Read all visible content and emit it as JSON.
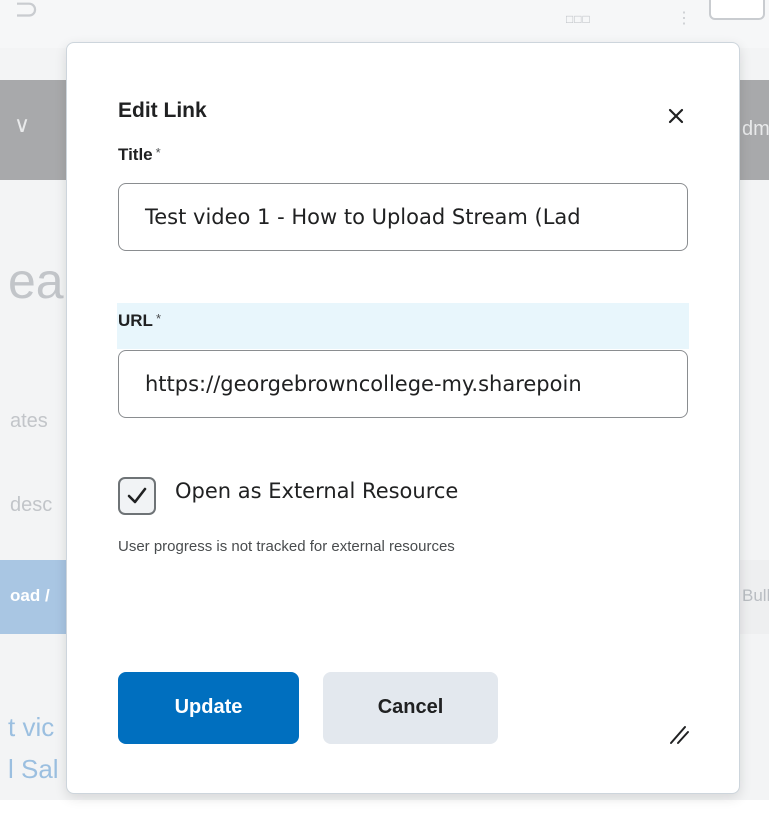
{
  "dialog": {
    "title": "Edit Link",
    "close_icon": "close-icon",
    "title_field": {
      "label": "Title",
      "required_mark": "*",
      "value": "Test video 1 - How to Upload Stream (Lad"
    },
    "url_field": {
      "label": "URL",
      "required_mark": "*",
      "value": "https://georgebrowncollege-my.sharepoin"
    },
    "external_resource": {
      "checked": true,
      "label": "Open as External Resource",
      "helper": "User progress is not tracked for external resources"
    },
    "buttons": {
      "update": "Update",
      "cancel": "Cancel"
    },
    "resize_icon": "resize-handle-icon"
  },
  "background": {
    "heading_fragment": "ea",
    "text_fragment_1": "ates",
    "text_fragment_2": "desc",
    "band_left_text": "oad /",
    "band_right_text": "Bull",
    "nav_right_text": "dm",
    "link_fragment_1": "t vic",
    "link_fragment_2": "l Sal"
  },
  "colors": {
    "primary": "#006fbf",
    "secondary_button": "#e3e8ee",
    "focus_highlight": "#e8f6fc",
    "text": "#202122"
  }
}
